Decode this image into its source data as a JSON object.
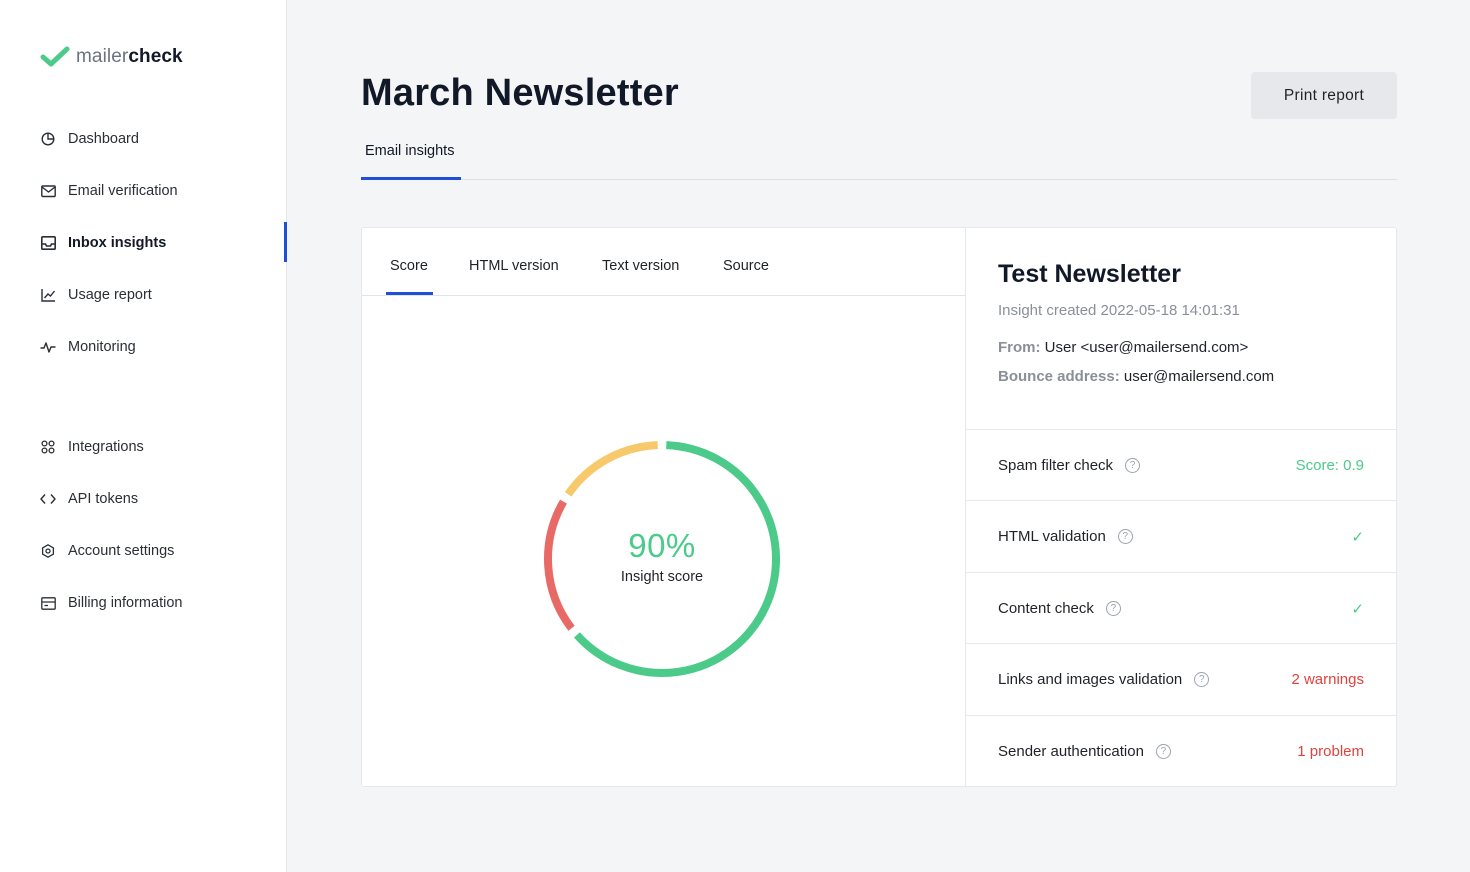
{
  "brand": {
    "light": "mailer",
    "bold": "check",
    "accent": "#4cca8a"
  },
  "sidebar": {
    "items": [
      {
        "label": "Dashboard",
        "icon": "pie-chart-icon"
      },
      {
        "label": "Email verification",
        "icon": "envelope-check-icon"
      },
      {
        "label": "Inbox insights",
        "icon": "inbox-icon",
        "active": true
      },
      {
        "label": "Usage report",
        "icon": "line-chart-icon"
      },
      {
        "label": "Monitoring",
        "icon": "pulse-icon"
      },
      {
        "label": "Integrations",
        "icon": "integrations-icon"
      },
      {
        "label": "API tokens",
        "icon": "code-icon"
      },
      {
        "label": "Account settings",
        "icon": "gear-icon"
      },
      {
        "label": "Billing information",
        "icon": "billing-icon"
      }
    ]
  },
  "header": {
    "title": "March Newsletter",
    "print_label": "Print report",
    "tab": "Email insights"
  },
  "tabs": [
    "Score",
    "HTML version",
    "Text version",
    "Source"
  ],
  "score": {
    "value": "90%",
    "label": "Insight score",
    "segments": [
      {
        "color": "#4cca8a",
        "fraction": 0.64
      },
      {
        "color": "#e86a66",
        "fraction": 0.2
      },
      {
        "color": "#f7c96a",
        "fraction": 0.16
      }
    ]
  },
  "insight": {
    "title": "Test Newsletter",
    "created": "Insight created 2022-05-18 14:01:31",
    "from_label": "From:",
    "from_value": "User <user@mailersend.com>",
    "bounce_label": "Bounce address:",
    "bounce_value": "user@mailersend.com"
  },
  "checks": [
    {
      "name": "Spam filter check",
      "status": "Score: 0.9",
      "status_type": "green"
    },
    {
      "name": "HTML validation",
      "status": "✓",
      "status_type": "green"
    },
    {
      "name": "Content check",
      "status": "✓",
      "status_type": "green"
    },
    {
      "name": "Links and images validation",
      "status": "2 warnings",
      "status_type": "red"
    },
    {
      "name": "Sender authentication",
      "status": "1 problem",
      "status_type": "red"
    }
  ],
  "colors": {
    "primary": "#1f4ed8",
    "success": "#4cca8a",
    "danger": "#e0423d",
    "warning": "#f7c96a"
  }
}
